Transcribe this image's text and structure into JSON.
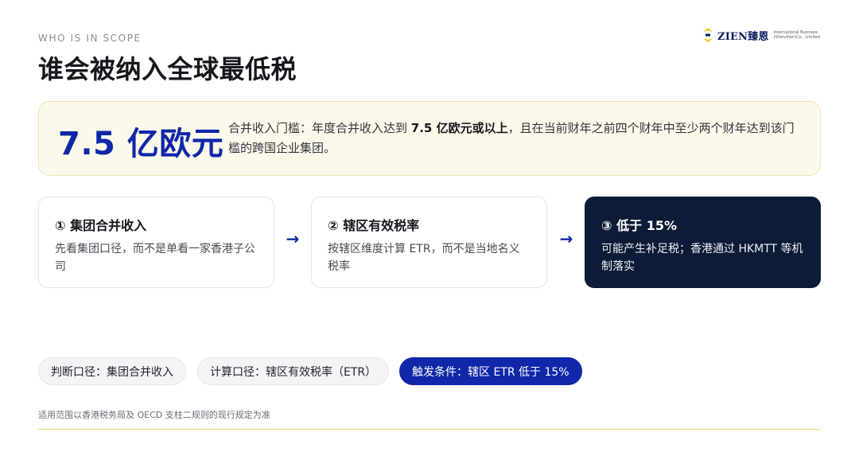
{
  "header": {
    "eyebrow": "WHO IS IN SCOPE",
    "title": "谁会被纳入全球最低税"
  },
  "logo": {
    "wordmark": "ZIEN臻恩",
    "sub_line1": "International Business",
    "sub_line2": "(Shenzhen)Co., Limited",
    "accent_color": "#f2c200",
    "brand_color": "#0b1f5c"
  },
  "threshold": {
    "figure": "7.5 亿欧元",
    "desc_before": "合并收入门槛：年度合并收入达到 ",
    "desc_bold": "7.5 亿欧元或以上",
    "desc_after": "，且在当前财年之前四个财年中至少两个财年达到该门槛的跨国企业集团。"
  },
  "steps": [
    {
      "title": "① 集团合并收入",
      "desc": "先看集团口径，而不是单看一家香港子公司"
    },
    {
      "title": "② 辖区有效税率",
      "desc": "按辖区维度计算 ETR，而不是当地名义税率"
    },
    {
      "title": "③ 低于 15%",
      "desc": "可能产生补足税；香港通过 HKMTT 等机制落实"
    }
  ],
  "arrows": {
    "glyph": "→",
    "color": "#0f27a8"
  },
  "chips": [
    {
      "label": "判断口径：集团合并收入",
      "active": false
    },
    {
      "label": "计算口径：辖区有效税率（ETR）",
      "active": false
    },
    {
      "label": "触发条件：辖区 ETR 低于 15%",
      "active": true
    }
  ],
  "footnote": "适用范围以香港税务局及 OECD 支柱二规则的现行规定为准",
  "colors": {
    "accent_blue": "#0f27a8",
    "navy": "#0c1b36",
    "highlight_bg": "#fdf9ea",
    "footer_line": "#f0d66c"
  }
}
